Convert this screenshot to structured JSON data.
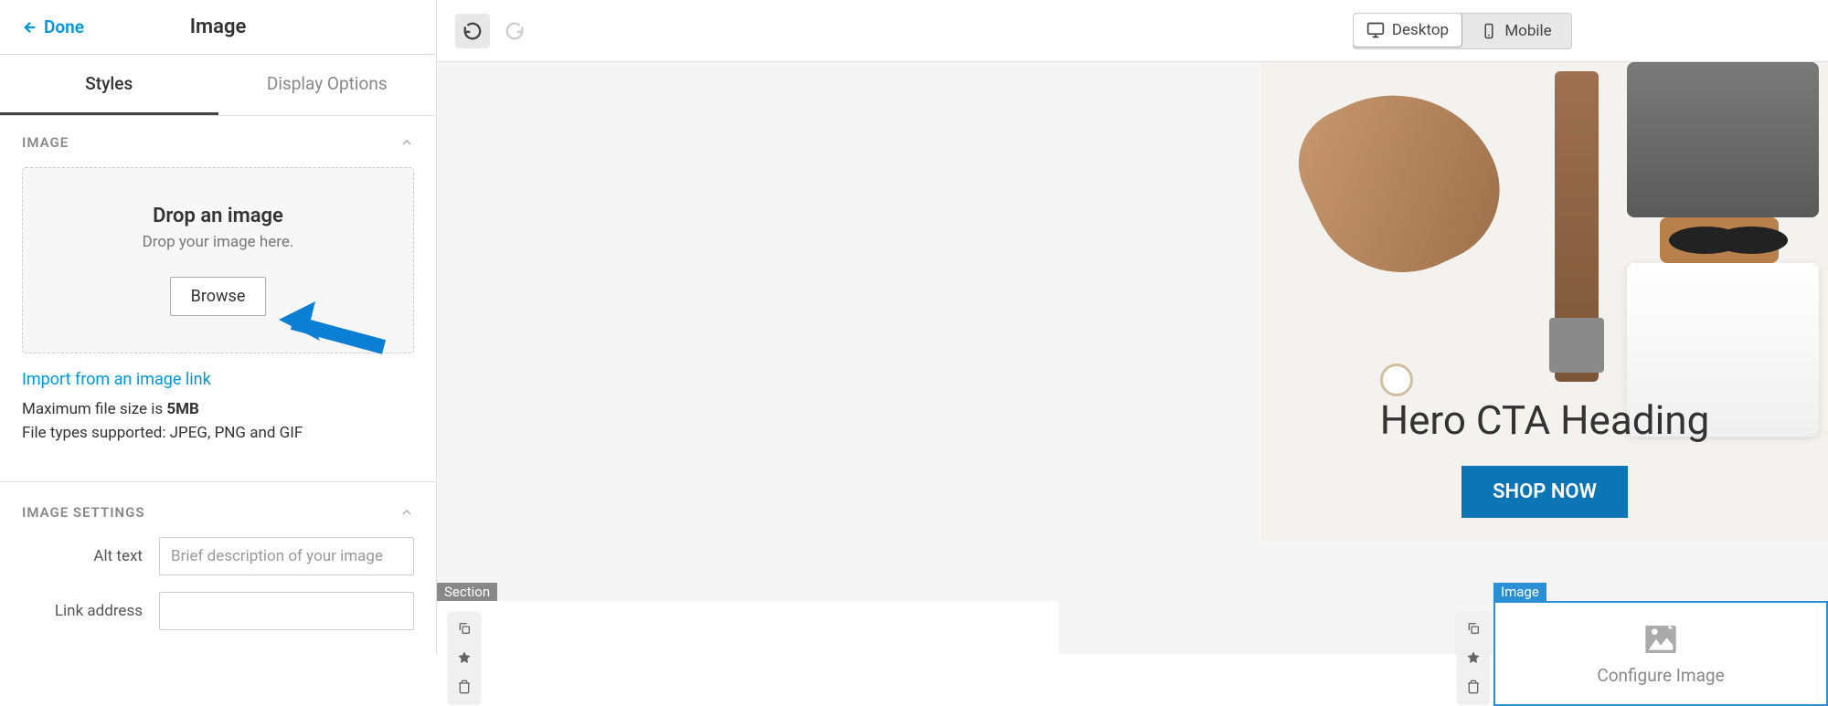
{
  "header": {
    "done_label": "Done",
    "title": "Image"
  },
  "tabs": {
    "styles": "Styles",
    "display_options": "Display Options"
  },
  "image_section": {
    "title": "IMAGE",
    "drop_title": "Drop an image",
    "drop_sub": "Drop your image here.",
    "browse": "Browse",
    "import_link": "Import from an image link",
    "max_size_prefix": "Maximum file size is ",
    "max_size": "5MB",
    "file_types": "File types supported: JPEG, PNG and GIF"
  },
  "settings_section": {
    "title": "IMAGE SETTINGS",
    "alt_text_label": "Alt text",
    "alt_text_placeholder": "Brief description of your image",
    "link_label": "Link address"
  },
  "toolbar": {
    "desktop": "Desktop",
    "mobile": "Mobile"
  },
  "hero": {
    "heading": "Hero CTA Heading",
    "button": "SHOP NOW"
  },
  "blocks": {
    "section_tag": "Section",
    "image_tag": "Image",
    "configure_text": "Configure Image"
  }
}
